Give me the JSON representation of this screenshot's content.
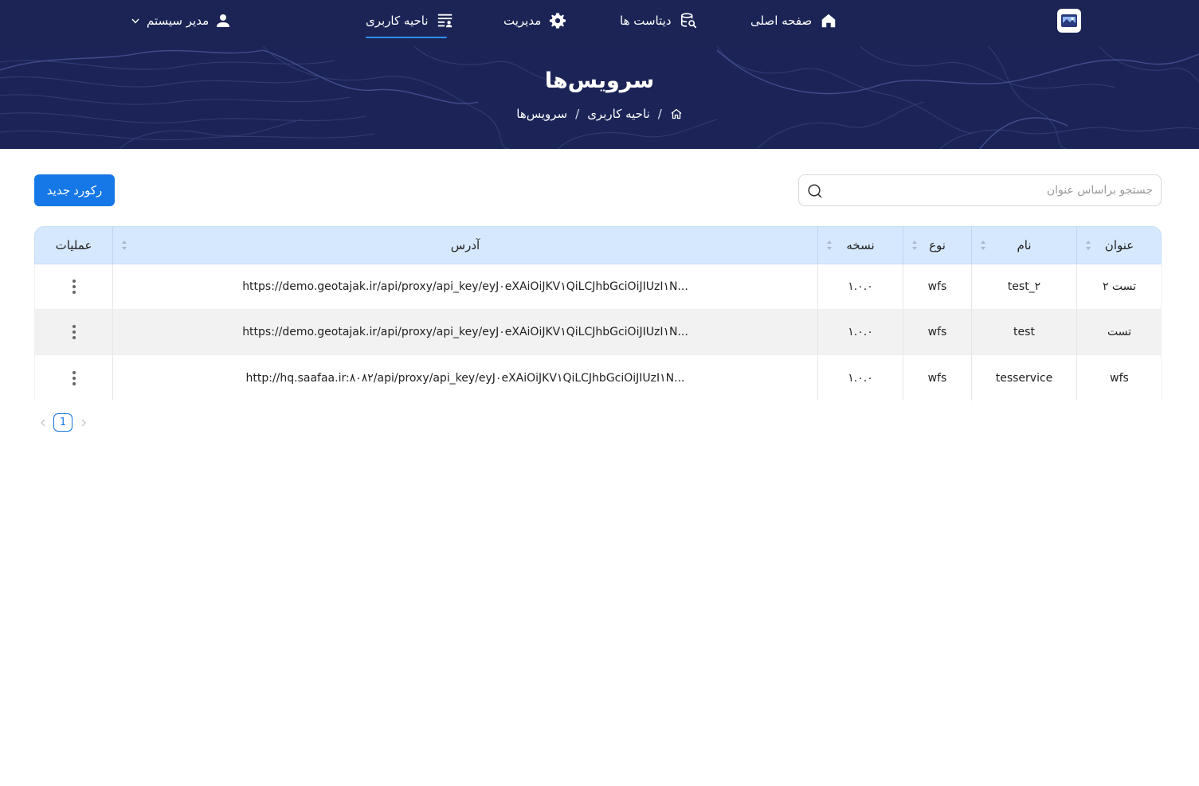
{
  "nav": {
    "items": [
      {
        "label": "صفحه اصلی",
        "icon": "home-icon"
      },
      {
        "label": "دیتاست ها",
        "icon": "dataset-search-icon"
      },
      {
        "label": "مدیریت",
        "icon": "gear-icon"
      },
      {
        "label": "ناحیه کاربری",
        "icon": "user-area-list-icon",
        "active": true
      }
    ],
    "user": {
      "label": "مدیر سیستم",
      "icon": "user-icon",
      "caret": "chevron-down-icon"
    },
    "colors": {
      "background": "#1b2455",
      "active_underline": "#2f8ef7"
    }
  },
  "banner": {
    "title": "سرویس‌ها",
    "breadcrumb": [
      "ناحیه کاربری",
      "سرویس‌ها"
    ],
    "separator": "/"
  },
  "toolbar": {
    "new_button": "رکورد جدید",
    "search_placeholder": "جستجو براساس عنوان"
  },
  "table": {
    "columns": [
      "عنوان",
      "نام",
      "نوع",
      "نسخه",
      "آدرس",
      "عملیات"
    ],
    "rows": [
      {
        "title": "تست ۲",
        "name": "test_۲",
        "type": "wfs",
        "version": "۱.۰.۰",
        "address": "https://demo.geotajak.ir/api/proxy/api_key/eyJ۰eXAiOiJKV۱QiLCJhbGciOiJIUzI۱N..."
      },
      {
        "title": "تست",
        "name": "test",
        "type": "wfs",
        "version": "۱.۰.۰",
        "address": "https://demo.geotajak.ir/api/proxy/api_key/eyJ۰eXAiOiJKV۱QiLCJhbGciOiJIUzI۱N..."
      },
      {
        "title": "wfs",
        "name": "tesservice",
        "type": "wfs",
        "version": "۱.۰.۰",
        "address": "http://hq.saafaa.ir:۸۰۸۲/api/proxy/api_key/eyJ۰eXAiOiJKV۱QiLCJhbGciOiJIUzI۱N..."
      }
    ]
  },
  "pagination": {
    "current_page": "1"
  },
  "colors": {
    "primary": "#1677e6",
    "table_header": "#d6e8fd"
  }
}
